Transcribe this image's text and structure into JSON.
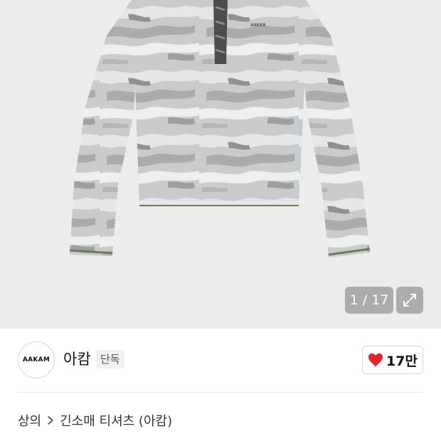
{
  "gallery": {
    "counter": "1 / 17",
    "product_logo": "AAKAM"
  },
  "brand": {
    "logo_text": "AAKAM",
    "name": "아캄",
    "badge": "단독"
  },
  "like": {
    "count": "17만",
    "heart_color": "#e8232b"
  },
  "breadcrumb": {
    "category": "상의",
    "subcategory": "긴소매 티셔츠 (아캄)"
  },
  "icons": {
    "expand": "expand-icon",
    "heart": "heart-icon",
    "chevron": "chevron-right-icon"
  }
}
